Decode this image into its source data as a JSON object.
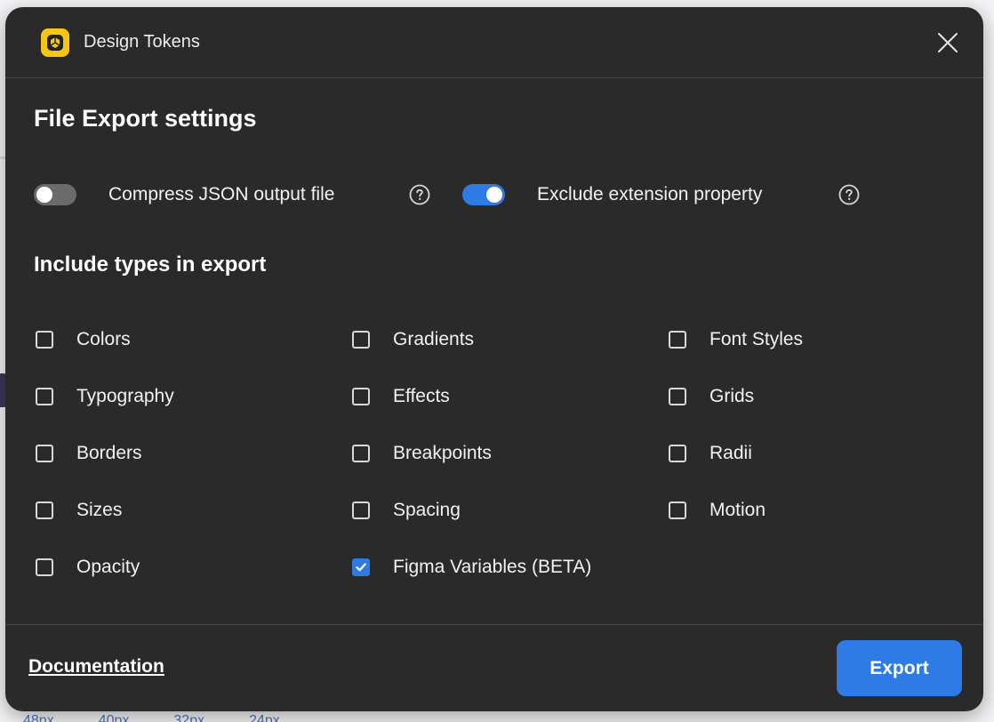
{
  "background": {
    "footer_values": [
      "48px",
      "40px",
      "32px",
      "24px"
    ]
  },
  "header": {
    "title": "Design Tokens",
    "icon": "design-tokens-logo-icon",
    "close_icon": "close-icon"
  },
  "export_settings": {
    "title": "File Export settings",
    "toggles": [
      {
        "label": "Compress JSON output file",
        "on": false
      },
      {
        "label": "Exclude extension property",
        "on": true
      }
    ]
  },
  "types": {
    "title": "Include types in export",
    "items": [
      {
        "label": "Colors",
        "checked": false
      },
      {
        "label": "Gradients",
        "checked": false
      },
      {
        "label": "Font Styles",
        "checked": false
      },
      {
        "label": "Typography",
        "checked": false
      },
      {
        "label": "Effects",
        "checked": false
      },
      {
        "label": "Grids",
        "checked": false
      },
      {
        "label": "Borders",
        "checked": false
      },
      {
        "label": "Breakpoints",
        "checked": false
      },
      {
        "label": "Radii",
        "checked": false
      },
      {
        "label": "Sizes",
        "checked": false
      },
      {
        "label": "Spacing",
        "checked": false
      },
      {
        "label": "Motion",
        "checked": false
      },
      {
        "label": "Opacity",
        "checked": false
      },
      {
        "label": "Figma Variables (BETA)",
        "checked": true
      }
    ]
  },
  "footer": {
    "documentation_label": "Documentation",
    "export_label": "Export"
  },
  "colors": {
    "modal_bg": "#2a2a2a",
    "accent": "#2f7be6",
    "toggle_off": "#6b6b6b",
    "icon_yellow": "#f5c518"
  }
}
